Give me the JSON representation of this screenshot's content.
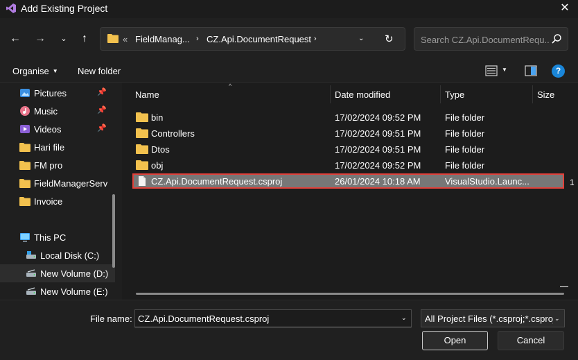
{
  "window": {
    "title": "Add Existing Project",
    "close_glyph": "✕",
    "app_icon": "visual-studio-icon"
  },
  "nav": {
    "back_glyph": "←",
    "forward_glyph": "→",
    "history_glyph": "⌄",
    "up_glyph": "↑",
    "breadcrumb_overflow": "«",
    "breadcrumbs": [
      "FieldManag...",
      "CZ.Api.DocumentRequest"
    ],
    "crumb_sep": "›",
    "dropdown_glyph": "⌄",
    "refresh_glyph": "↻",
    "search_placeholder": "Search CZ.Api.DocumentRequ..."
  },
  "commandbar": {
    "organise_label": "Organise",
    "organise_caret": "▼",
    "new_folder_label": "New folder",
    "view_caret": "▼",
    "help_glyph": "?"
  },
  "sidebar": {
    "pin_glyph": "📌",
    "items": [
      {
        "label": "Pictures",
        "icon": "pictures-icon",
        "pinned": true
      },
      {
        "label": "Music",
        "icon": "music-icon",
        "pinned": true
      },
      {
        "label": "Videos",
        "icon": "videos-icon",
        "pinned": true
      },
      {
        "label": "Hari file",
        "icon": "folder-icon",
        "pinned": false
      },
      {
        "label": "FM pro",
        "icon": "folder-icon",
        "pinned": false
      },
      {
        "label": "FieldManagerServ",
        "icon": "folder-icon",
        "pinned": false
      },
      {
        "label": "Invoice",
        "icon": "folder-icon",
        "pinned": false
      },
      {
        "label": "This PC",
        "icon": "computer-icon",
        "pinned": false
      },
      {
        "label": "Local Disk (C:)",
        "icon": "drive-icon",
        "pinned": false
      },
      {
        "label": "New Volume (D:)",
        "icon": "drive-icon",
        "pinned": false
      },
      {
        "label": "New Volume (E:)",
        "icon": "drive-icon",
        "pinned": false
      }
    ]
  },
  "filelist": {
    "sort_caret": "^",
    "columns": [
      "Name",
      "Date modified",
      "Type",
      "Size"
    ],
    "rows": [
      {
        "name": "bin",
        "date": "17/02/2024 09:52 PM",
        "type": "File folder",
        "icon": "folder-icon"
      },
      {
        "name": "Controllers",
        "date": "17/02/2024 09:51 PM",
        "type": "File folder",
        "icon": "folder-icon"
      },
      {
        "name": "Dtos",
        "date": "17/02/2024 09:51 PM",
        "type": "File folder",
        "icon": "folder-icon"
      },
      {
        "name": "obj",
        "date": "17/02/2024 09:52 PM",
        "type": "File folder",
        "icon": "folder-icon"
      },
      {
        "name": "CZ.Api.DocumentRequest.csproj",
        "date": "26/01/2024 10:18 AM",
        "type": "VisualStudio.Launc...",
        "icon": "file-icon"
      }
    ],
    "selected_size_fragment": "1"
  },
  "bottom": {
    "filename_label": "File name:",
    "filename_value": "CZ.Api.DocumentRequest.csproj",
    "filename_drop": "⌄",
    "filter_value": "All Project Files (*.csproj;*.csproj",
    "filter_drop": "⌄",
    "open_label": "Open",
    "cancel_label": "Cancel"
  },
  "colors": {
    "background": "#202020",
    "selection_outline": "#e0413a",
    "folder": "#f2c14e",
    "help_accent": "#1a86d9"
  }
}
